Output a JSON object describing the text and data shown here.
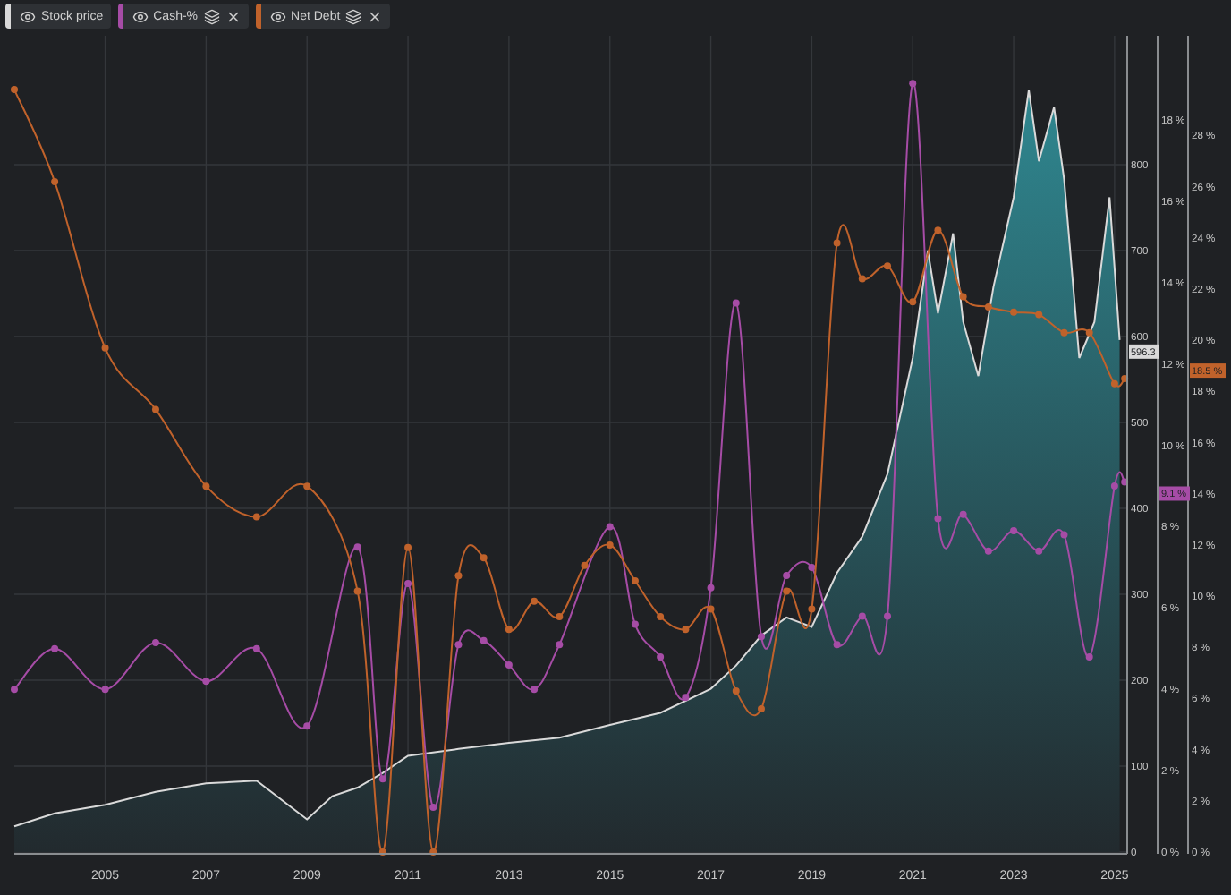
{
  "legend": [
    {
      "kind": "plain"
    },
    {
      "kind": "removable"
    },
    {
      "kind": "removable"
    }
  ],
  "chart_data": {
    "type": "line",
    "xlim": [
      2003.2,
      2025.25
    ],
    "xticks": [
      2005,
      2007,
      2009,
      2011,
      2013,
      2015,
      2017,
      2019,
      2021,
      2023,
      2025
    ],
    "grid": true,
    "ylim": [
      0,
      950
    ],
    "yticks": [
      0,
      100,
      200,
      300,
      400,
      500,
      600,
      700,
      800
    ],
    "y2lim": [
      0,
      20.07
    ],
    "y2ticks": [
      {
        "value": 0,
        "label": "0 %"
      },
      {
        "value": 2,
        "label": "2 %"
      },
      {
        "value": 4,
        "label": "4 %"
      },
      {
        "value": 6,
        "label": "6 %"
      },
      {
        "value": 8,
        "label": "8 %"
      },
      {
        "value": 10,
        "label": "10 %"
      },
      {
        "value": 12,
        "label": "12 %"
      },
      {
        "value": 14,
        "label": "14 %"
      },
      {
        "value": 16,
        "label": "16 %"
      },
      {
        "value": 18,
        "label": "18 %"
      }
    ],
    "y3lim": [
      0,
      31.9
    ],
    "y3ticks": [
      {
        "value": 0,
        "label": "0 %"
      },
      {
        "value": 2,
        "label": "2 %"
      },
      {
        "value": 4,
        "label": "4 %"
      },
      {
        "value": 6,
        "label": "6 %"
      },
      {
        "value": 8,
        "label": "8 %"
      },
      {
        "value": 10,
        "label": "10 %"
      },
      {
        "value": 12,
        "label": "12 %"
      },
      {
        "value": 14,
        "label": "14 %"
      },
      {
        "value": 16,
        "label": "16 %"
      },
      {
        "value": 18,
        "label": "18 %"
      },
      {
        "value": 20,
        "label": "20 %"
      },
      {
        "value": 22,
        "label": "22 %"
      },
      {
        "value": 24,
        "label": "24 %"
      },
      {
        "value": 26,
        "label": "26 %"
      },
      {
        "value": 28,
        "label": "28 %"
      }
    ],
    "series": [
      {
        "name": "Stock price",
        "color": "#d9d9d9",
        "type": "area",
        "axis": "y",
        "x": [
          2003.2,
          2004,
          2005,
          2006,
          2007,
          2008,
          2009,
          2009.5,
          2010,
          2010.5,
          2011,
          2012,
          2013,
          2014,
          2015,
          2016,
          2017,
          2017.5,
          2018,
          2018.5,
          2019,
          2019.5,
          2020,
          2020.5,
          2021,
          2021.3,
          2021.5,
          2021.8,
          2022,
          2022.3,
          2022.6,
          2023,
          2023.3,
          2023.5,
          2023.8,
          2024,
          2024.3,
          2024.6,
          2024.9,
          2025.1
        ],
        "values": [
          30,
          45,
          55,
          70,
          80,
          83,
          38,
          65,
          75,
          92,
          112,
          120,
          127,
          133,
          148,
          162,
          190,
          217,
          252,
          273,
          262,
          325,
          367,
          440,
          575,
          700,
          627,
          720,
          617,
          554,
          658,
          762,
          887,
          804,
          867,
          783,
          575,
          617,
          762,
          596
        ]
      },
      {
        "name": "Cash-%",
        "color": "#a64ca6",
        "type": "line",
        "marker": "circle",
        "axis": "y2",
        "x": [
          2003.2,
          2004,
          2005,
          2006,
          2007,
          2008,
          2009,
          2010,
          2010.5,
          2011,
          2011.5,
          2012,
          2012.5,
          2013,
          2013.5,
          2014,
          2015,
          2015.5,
          2016,
          2016.5,
          2017,
          2017.5,
          2018,
          2018.5,
          2019,
          2019.5,
          2020,
          2020.5,
          2021,
          2021.5,
          2022,
          2022.5,
          2023,
          2023.5,
          2024,
          2024.5,
          2025,
          2025.2
        ],
        "values": [
          4.0,
          5.0,
          4.0,
          5.15,
          4.2,
          5.0,
          3.1,
          7.5,
          1.8,
          6.6,
          1.1,
          5.1,
          5.2,
          4.6,
          4.0,
          5.1,
          8.0,
          5.6,
          4.8,
          3.8,
          6.5,
          13.5,
          5.3,
          6.8,
          7.0,
          5.1,
          5.8,
          5.8,
          18.9,
          8.2,
          8.3,
          7.4,
          7.9,
          7.4,
          7.8,
          4.8,
          9.0,
          9.1
        ]
      },
      {
        "name": "Net Debt",
        "color": "#c0622b",
        "type": "line",
        "marker": "circle",
        "axis": "y3",
        "x": [
          2003.2,
          2004,
          2005,
          2006,
          2007,
          2008,
          2009,
          2010,
          2010.5,
          2011,
          2011.5,
          2012,
          2012.5,
          2013,
          2013.5,
          2014,
          2014.5,
          2015,
          2015.5,
          2016,
          2016.5,
          2017,
          2017.5,
          2018,
          2018.5,
          2019,
          2019.5,
          2020,
          2020.5,
          2021,
          2021.5,
          2022,
          2022.5,
          2023,
          2023.5,
          2024,
          2024.5,
          2025,
          2025.2
        ],
        "values": [
          29.8,
          26.2,
          19.7,
          17.3,
          14.3,
          13.1,
          14.3,
          10.2,
          0,
          11.9,
          0,
          10.8,
          11.5,
          8.7,
          9.8,
          9.2,
          11.2,
          12.0,
          10.6,
          9.2,
          8.7,
          9.5,
          6.3,
          5.6,
          10.2,
          9.5,
          23.8,
          22.4,
          22.9,
          21.5,
          24.3,
          21.7,
          21.3,
          21.1,
          21.0,
          20.3,
          20.3,
          18.3,
          18.5
        ]
      }
    ]
  },
  "value_badges": [
    "596.3",
    "9.1 %",
    "18.5 %"
  ]
}
